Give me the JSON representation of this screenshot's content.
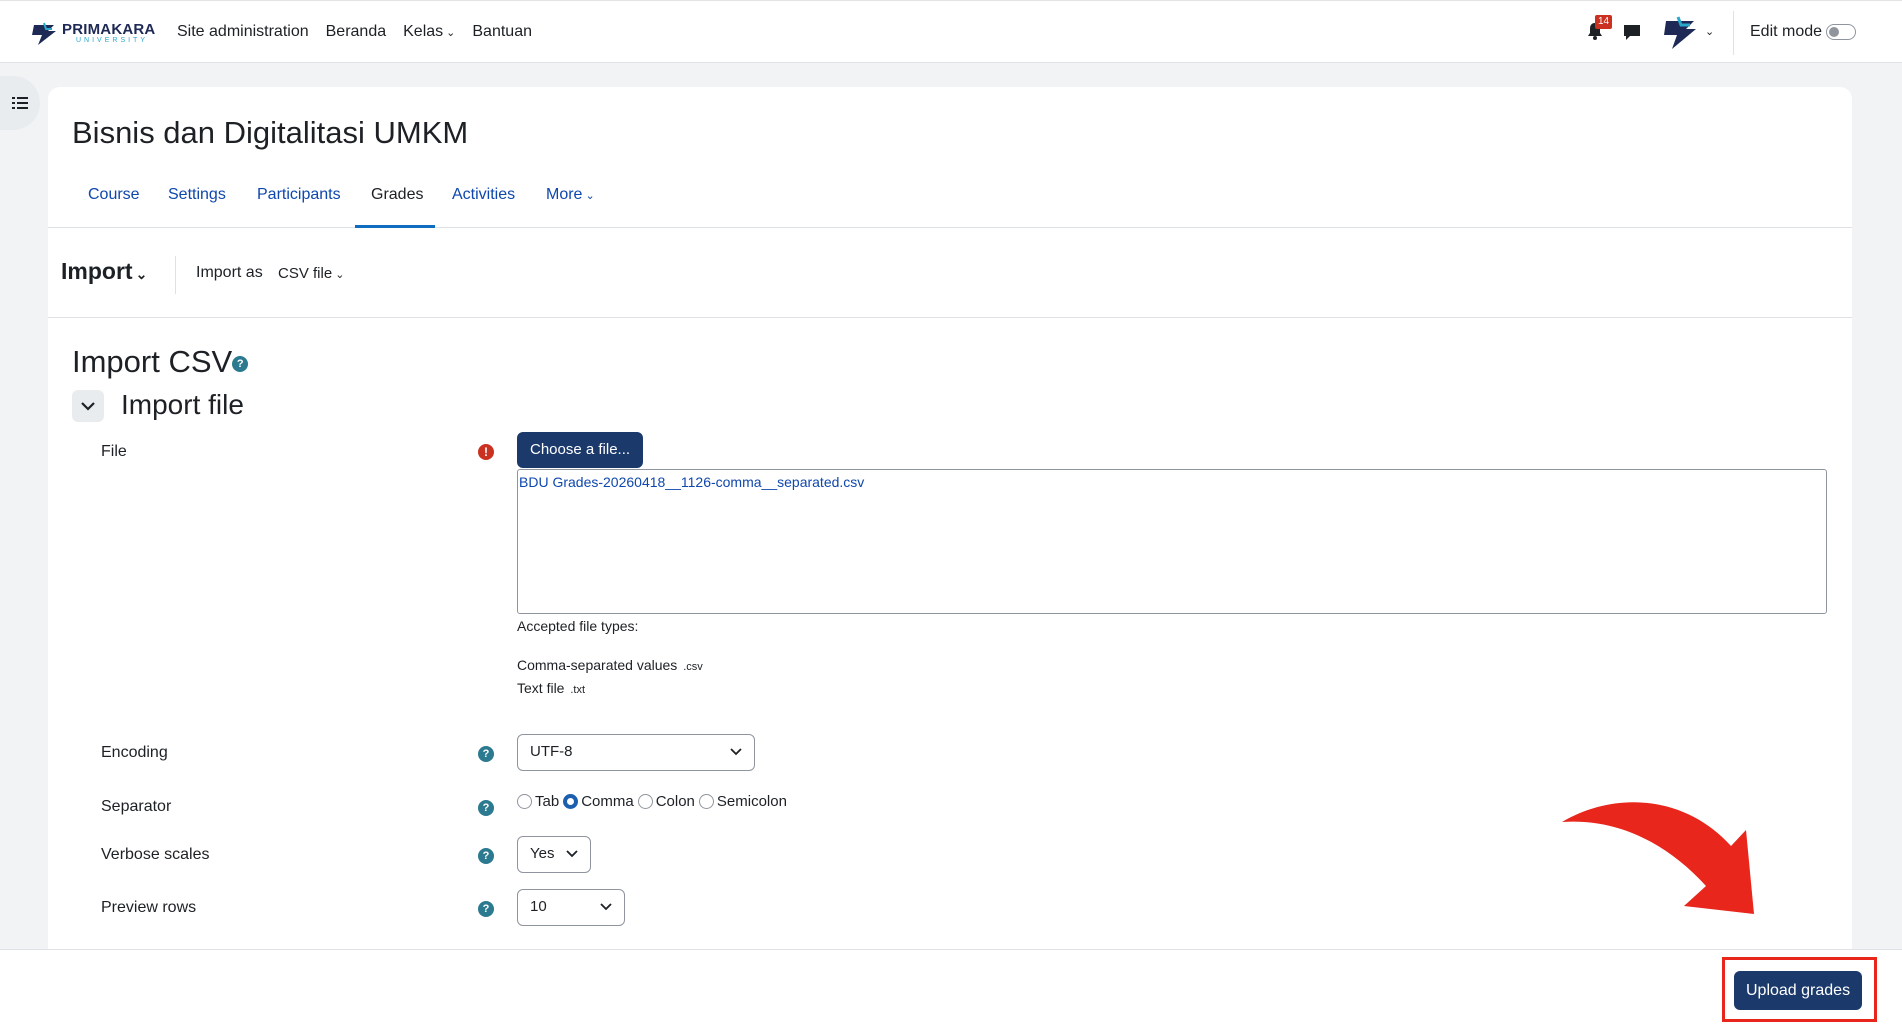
{
  "header": {
    "logo": {
      "main": "PRIMAKARA",
      "sub": "UNIVERSITY"
    },
    "nav": [
      {
        "label": "Site administration"
      },
      {
        "label": "Beranda"
      },
      {
        "label": "Kelas"
      },
      {
        "label": "Bantuan"
      }
    ],
    "notification_count": "14",
    "edit_mode_label": "Edit mode"
  },
  "course": {
    "title": "Bisnis dan Digitalitasi UMKM",
    "tabs": [
      {
        "label": "Course"
      },
      {
        "label": "Settings"
      },
      {
        "label": "Participants"
      },
      {
        "label": "Grades",
        "active": true
      },
      {
        "label": "Activities"
      },
      {
        "label": "More"
      }
    ]
  },
  "tertiary": {
    "import_label": "Import",
    "import_as_label": "Import as",
    "import_as_value": "CSV file"
  },
  "page": {
    "heading": "Import CSV",
    "section_heading": "Import file"
  },
  "form": {
    "file_label": "File",
    "choose_button": "Choose a file...",
    "selected_file": "BDU Grades-20260418__1126-comma__separated.csv",
    "accepted_heading": "Accepted file types:",
    "accepted_types": [
      {
        "name": "Comma-separated values",
        "ext": ".csv"
      },
      {
        "name": "Text file",
        "ext": ".txt"
      }
    ],
    "encoding_label": "Encoding",
    "encoding_value": "UTF-8",
    "separator_label": "Separator",
    "separator_options": [
      "Tab",
      "Comma",
      "Colon",
      "Semicolon"
    ],
    "separator_selected": "Comma",
    "verbose_label": "Verbose scales",
    "verbose_value": "Yes",
    "preview_label": "Preview rows",
    "preview_value": "10"
  },
  "footer": {
    "upload_button": "Upload grades"
  },
  "colors": {
    "primary_button": "#1b3a6b",
    "link": "#0f47ad",
    "highlight_box": "#e8261c",
    "badge": "#ca3120"
  }
}
